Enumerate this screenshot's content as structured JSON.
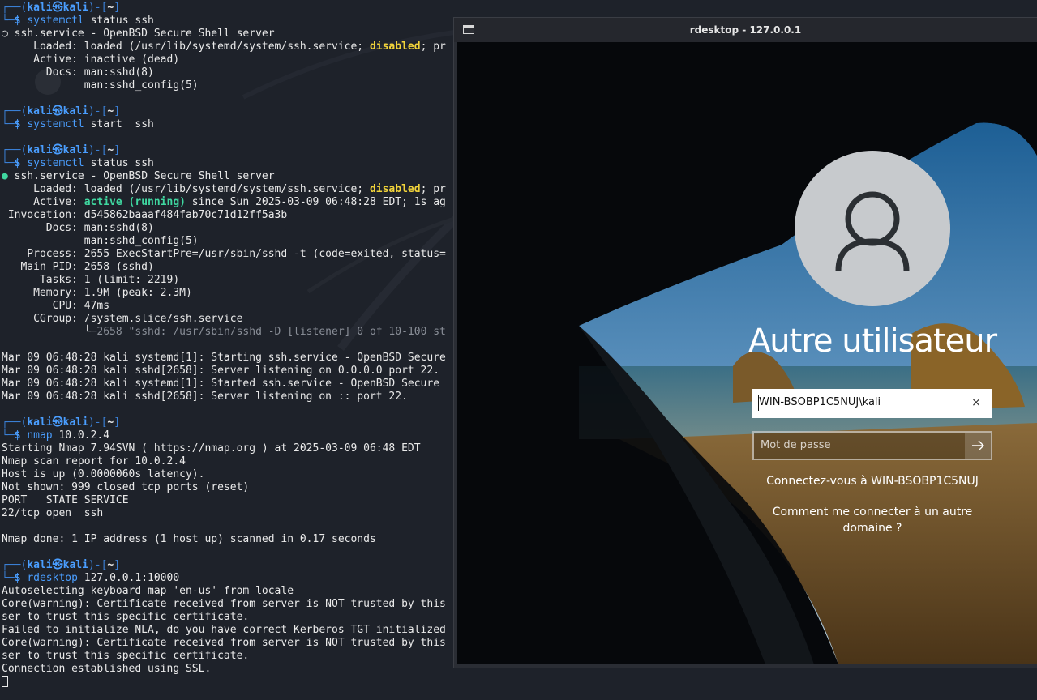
{
  "terminal": {
    "lines": [
      [
        {
          "t": "┌──(",
          "c": "frame"
        },
        {
          "t": "kali㉿kali",
          "c": "user"
        },
        {
          "t": ")-[",
          "c": "frame"
        },
        {
          "t": "~",
          "c": "dir"
        },
        {
          "t": "]",
          "c": "frame"
        }
      ],
      [
        {
          "t": "└─",
          "c": "frame"
        },
        {
          "t": "$ ",
          "c": "user"
        },
        {
          "t": "systemctl",
          "c": "cmd"
        },
        {
          "t": " status ssh"
        }
      ],
      [
        {
          "t": "○ ssh.service - OpenBSD Secure Shell server"
        }
      ],
      [
        {
          "t": "     Loaded: loaded (/usr/lib/systemd/system/ssh.service; "
        },
        {
          "t": "disabled",
          "c": "yellow"
        },
        {
          "t": "; pr"
        }
      ],
      [
        {
          "t": "     Active: inactive (dead)"
        }
      ],
      [
        {
          "t": "       Docs: man:sshd(8)"
        }
      ],
      [
        {
          "t": "             man:sshd_config(5)"
        }
      ],
      [
        {
          "t": ""
        }
      ],
      [
        {
          "t": "┌──(",
          "c": "frame"
        },
        {
          "t": "kali㉿kali",
          "c": "user"
        },
        {
          "t": ")-[",
          "c": "frame"
        },
        {
          "t": "~",
          "c": "dir"
        },
        {
          "t": "]",
          "c": "frame"
        }
      ],
      [
        {
          "t": "└─",
          "c": "frame"
        },
        {
          "t": "$ ",
          "c": "user"
        },
        {
          "t": "systemctl",
          "c": "cmd"
        },
        {
          "t": " start  ssh"
        }
      ],
      [
        {
          "t": ""
        }
      ],
      [
        {
          "t": "┌──(",
          "c": "frame"
        },
        {
          "t": "kali㉿kali",
          "c": "user"
        },
        {
          "t": ")-[",
          "c": "frame"
        },
        {
          "t": "~",
          "c": "dir"
        },
        {
          "t": "]",
          "c": "frame"
        }
      ],
      [
        {
          "t": "└─",
          "c": "frame"
        },
        {
          "t": "$ ",
          "c": "user"
        },
        {
          "t": "systemctl",
          "c": "cmd"
        },
        {
          "t": " status ssh"
        }
      ],
      [
        {
          "t": "●",
          "c": "dotgreen"
        },
        {
          "t": " ssh.service - OpenBSD Secure Shell server"
        }
      ],
      [
        {
          "t": "     Loaded: loaded (/usr/lib/systemd/system/ssh.service; "
        },
        {
          "t": "disabled",
          "c": "yellow"
        },
        {
          "t": "; pr"
        }
      ],
      [
        {
          "t": "     Active: "
        },
        {
          "t": "active (running)",
          "c": "green"
        },
        {
          "t": " since Sun 2025-03-09 06:48:28 EDT; 1s ag"
        }
      ],
      [
        {
          "t": " Invocation: d545862baaaf484fab70c71d12ff5a3b"
        }
      ],
      [
        {
          "t": "       Docs: man:sshd(8)"
        }
      ],
      [
        {
          "t": "             man:sshd_config(5)"
        }
      ],
      [
        {
          "t": "    Process: 2655 ExecStartPre=/usr/sbin/sshd -t (code=exited, status="
        }
      ],
      [
        {
          "t": "   Main PID: 2658 (sshd)"
        }
      ],
      [
        {
          "t": "      Tasks: 1 (limit: 2219)"
        }
      ],
      [
        {
          "t": "     Memory: 1.9M (peak: 2.3M)"
        }
      ],
      [
        {
          "t": "        CPU: 47ms"
        }
      ],
      [
        {
          "t": "     CGroup: /system.slice/ssh.service"
        }
      ],
      [
        {
          "t": "             └─"
        },
        {
          "t": "2658 \"sshd: /usr/sbin/sshd -D [listener] 0 of 10-100 st",
          "c": "dim"
        }
      ],
      [
        {
          "t": ""
        }
      ],
      [
        {
          "t": "Mar 09 06:48:28 kali systemd[1]: Starting ssh.service - OpenBSD Secure"
        }
      ],
      [
        {
          "t": "Mar 09 06:48:28 kali sshd[2658]: Server listening on 0.0.0.0 port 22."
        }
      ],
      [
        {
          "t": "Mar 09 06:48:28 kali systemd[1]: Started ssh.service - OpenBSD Secure"
        }
      ],
      [
        {
          "t": "Mar 09 06:48:28 kali sshd[2658]: Server listening on :: port 22."
        }
      ],
      [
        {
          "t": ""
        }
      ],
      [
        {
          "t": "┌──(",
          "c": "frame"
        },
        {
          "t": "kali㉿kali",
          "c": "user"
        },
        {
          "t": ")-[",
          "c": "frame"
        },
        {
          "t": "~",
          "c": "dir"
        },
        {
          "t": "]",
          "c": "frame"
        }
      ],
      [
        {
          "t": "└─",
          "c": "frame"
        },
        {
          "t": "$ ",
          "c": "user"
        },
        {
          "t": "nmap",
          "c": "cmd"
        },
        {
          "t": " 10.0.2.4"
        }
      ],
      [
        {
          "t": "Starting Nmap 7.94SVN ( https://nmap.org ) at 2025-03-09 06:48 EDT"
        }
      ],
      [
        {
          "t": "Nmap scan report for 10.0.2.4"
        }
      ],
      [
        {
          "t": "Host is up (0.0000060s latency)."
        }
      ],
      [
        {
          "t": "Not shown: 999 closed tcp ports (reset)"
        }
      ],
      [
        {
          "t": "PORT   STATE SERVICE"
        }
      ],
      [
        {
          "t": "22/tcp open  ssh"
        }
      ],
      [
        {
          "t": ""
        }
      ],
      [
        {
          "t": "Nmap done: 1 IP address (1 host up) scanned in 0.17 seconds"
        }
      ],
      [
        {
          "t": ""
        }
      ],
      [
        {
          "t": "┌──(",
          "c": "frame"
        },
        {
          "t": "kali㉿kali",
          "c": "user"
        },
        {
          "t": ")-[",
          "c": "frame"
        },
        {
          "t": "~",
          "c": "dir"
        },
        {
          "t": "]",
          "c": "frame"
        }
      ],
      [
        {
          "t": "└─",
          "c": "frame"
        },
        {
          "t": "$ ",
          "c": "user"
        },
        {
          "t": "rdesktop",
          "c": "cmd"
        },
        {
          "t": " 127.0.0.1:10000"
        }
      ],
      [
        {
          "t": "Autoselecting keyboard map 'en-us' from locale"
        }
      ],
      [
        {
          "t": "Core(warning): Certificate received from server is NOT trusted by this"
        }
      ],
      [
        {
          "t": "ser to trust this specific certificate."
        }
      ],
      [
        {
          "t": "Failed to initialize NLA, do you have correct Kerberos TGT initialized"
        }
      ],
      [
        {
          "t": "Core(warning): Certificate received from server is NOT trusted by this"
        }
      ],
      [
        {
          "t": "ser to trust this specific certificate."
        }
      ],
      [
        {
          "t": "Connection established using SSL."
        }
      ]
    ]
  },
  "rdesktop": {
    "title": "rdesktop - 127.0.0.1",
    "menu_icon": "window-menu-icon",
    "login": {
      "user_title": "Autre utilisateur",
      "username_value": "WIN-BSOBP1C5NUJ\\kali",
      "clear_icon": "×",
      "password_placeholder": "Mot de passe",
      "submit_icon": "arrow-right-icon",
      "sign_in_to": "Connectez-vous à WIN-BSOBP1C5NUJ",
      "other_domain": "Comment me connecter à un autre domaine ?"
    }
  },
  "colors": {
    "terminal_bg": "#1e222a",
    "prompt_blue": "#4a9eff",
    "disabled_yellow": "#f2d43a",
    "active_green": "#3fd7a0"
  }
}
